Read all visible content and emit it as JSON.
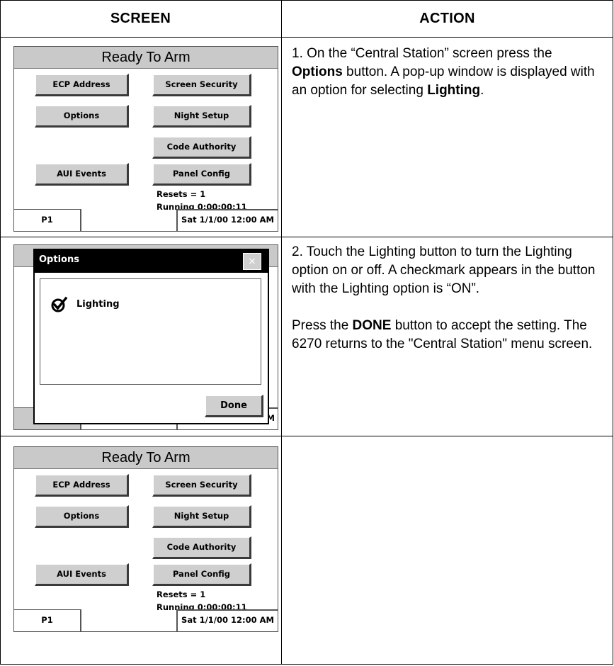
{
  "headers": {
    "screen": "SCREEN",
    "action": "ACTION"
  },
  "screen1": {
    "title": "Ready To Arm",
    "buttons": {
      "ecp_address": "ECP Address",
      "screen_security": "Screen Security",
      "options": "Options",
      "night_setup": "Night Setup",
      "code_authority": "Code Authority",
      "aui_events": "AUI Events",
      "panel_config": "Panel Config"
    },
    "resets": "Resets = 1",
    "running": "Running 0:00:00:11",
    "page": "P1",
    "datetime": "Sat 1/1/00 12:00 AM"
  },
  "popup": {
    "title": "Options",
    "close": "×",
    "lighting_label": "Lighting",
    "lighting_checked": true,
    "done": "Done",
    "footer_peek": "AM"
  },
  "screen3": {
    "title": "Ready To Arm",
    "buttons": {
      "ecp_address": "ECP Address",
      "screen_security": "Screen Security",
      "options": "Options",
      "night_setup": "Night Setup",
      "code_authority": "Code Authority",
      "aui_events": "AUI Events",
      "panel_config": "Panel Config"
    },
    "resets": "Resets = 1",
    "running": "Running 0:00:00:11",
    "page": "P1",
    "datetime": "Sat 1/1/00 12:00 AM"
  },
  "actions": {
    "step1": {
      "pre": "1.  On the “Central Station” screen press the ",
      "bold1": "Options",
      "mid": " button.  A pop-up window is displayed with an option for selecting ",
      "bold2": "Lighting",
      "post": "."
    },
    "step2": {
      "para1": "2.  Touch the Lighting button to turn the Lighting option on or off. A checkmark appears in the button with the Lighting option is “ON”.",
      "pre": "Press the ",
      "bold": "DONE",
      "post": " button to accept the setting.  The 6270 returns to the \"Central Station\" menu screen."
    }
  }
}
